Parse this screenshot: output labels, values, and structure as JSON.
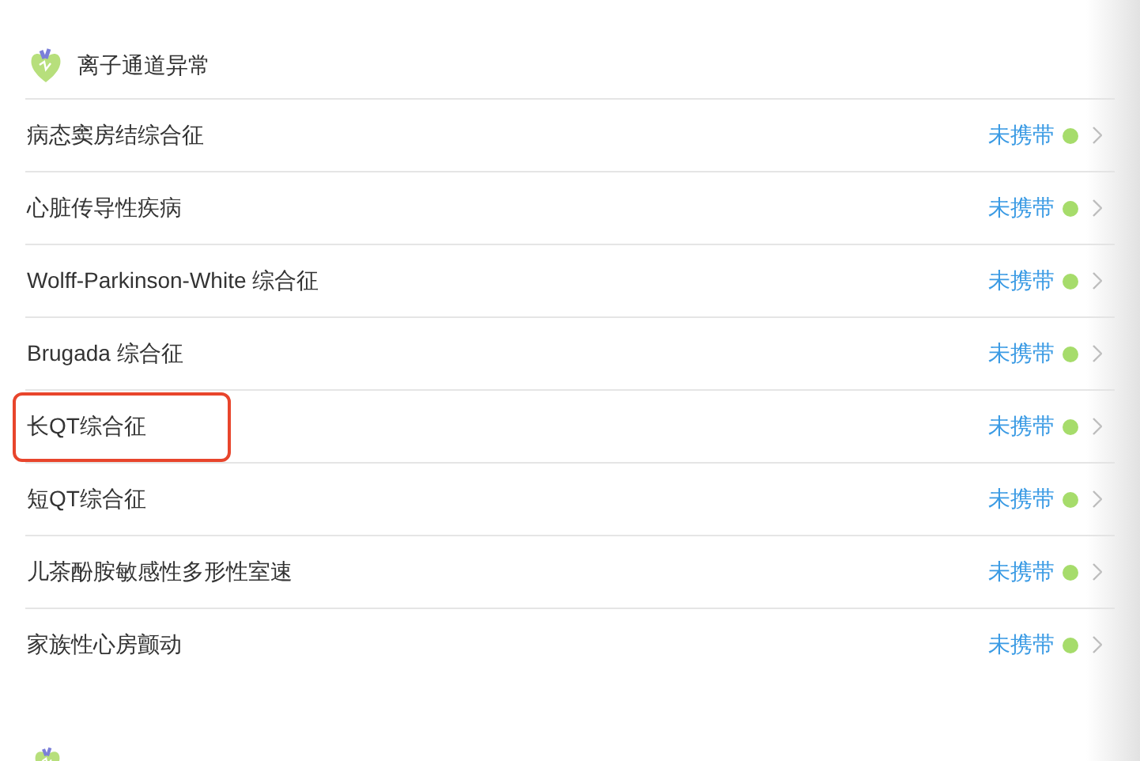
{
  "section": {
    "title": "离子通道异常"
  },
  "rows": [
    {
      "label": "病态窦房结综合征",
      "status": "未携带",
      "color": "#a6dc6b",
      "highlighted": false
    },
    {
      "label": "心脏传导性疾病",
      "status": "未携带",
      "color": "#a6dc6b",
      "highlighted": false
    },
    {
      "label": "Wolff-Parkinson-White 综合征",
      "status": "未携带",
      "color": "#a6dc6b",
      "highlighted": false
    },
    {
      "label": "Brugada 综合征",
      "status": "未携带",
      "color": "#a6dc6b",
      "highlighted": false
    },
    {
      "label": "长QT综合征",
      "status": "未携带",
      "color": "#a6dc6b",
      "highlighted": true
    },
    {
      "label": "短QT综合征",
      "status": "未携带",
      "color": "#a6dc6b",
      "highlighted": false
    },
    {
      "label": "儿茶酚胺敏感性多形性室速",
      "status": "未携带",
      "color": "#a6dc6b",
      "highlighted": false
    },
    {
      "label": "家族性心房颤动",
      "status": "未携带",
      "color": "#a6dc6b",
      "highlighted": false
    }
  ]
}
